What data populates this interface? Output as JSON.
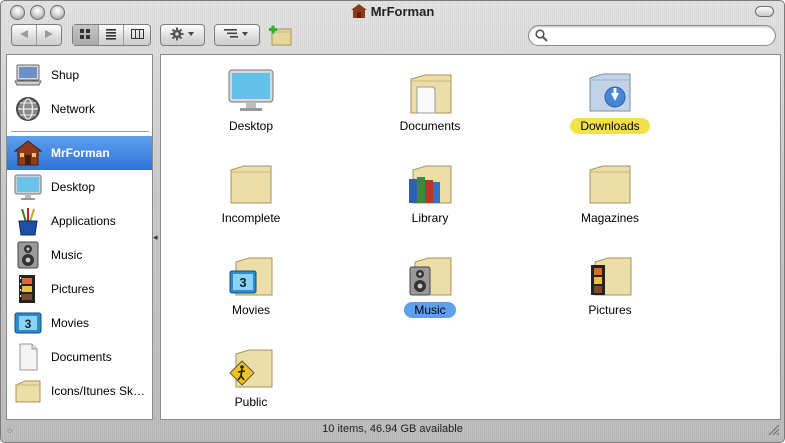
{
  "window": {
    "title": "MrForman"
  },
  "toolbar": {
    "back_icon": "back-arrow-icon",
    "forward_icon": "forward-arrow-icon",
    "view_icons": "icon-view-icon",
    "view_list": "list-view-icon",
    "view_columns": "column-view-icon",
    "action_icon": "gear-icon",
    "arrange_icon": "arrange-icon",
    "new_folder_icon": "new-folder-icon",
    "search_placeholder": "",
    "search_value": ""
  },
  "sidebar": {
    "devices": [
      {
        "label": "Shup",
        "icon": "laptop-icon"
      },
      {
        "label": "Network",
        "icon": "network-globe-icon"
      }
    ],
    "places": [
      {
        "label": "MrForman",
        "icon": "home-icon",
        "selected": true
      },
      {
        "label": "Desktop",
        "icon": "desktop-icon"
      },
      {
        "label": "Applications",
        "icon": "applications-icon"
      },
      {
        "label": "Music",
        "icon": "music-folder-icon"
      },
      {
        "label": "Pictures",
        "icon": "pictures-folder-icon"
      },
      {
        "label": "Movies",
        "icon": "movies-folder-icon"
      },
      {
        "label": "Documents",
        "icon": "documents-icon"
      },
      {
        "label": "Icons/Itunes Sk…",
        "icon": "folder-icon"
      }
    ]
  },
  "items": [
    {
      "label": "Desktop",
      "icon": "desktop-icon"
    },
    {
      "label": "Documents",
      "icon": "documents-folder-icon"
    },
    {
      "label": "Downloads",
      "icon": "downloads-folder-icon",
      "label_color": "#f2e24a"
    },
    {
      "label": "Incomplete",
      "icon": "folder-icon"
    },
    {
      "label": "Library",
      "icon": "library-folder-icon"
    },
    {
      "label": "Magazines",
      "icon": "folder-icon"
    },
    {
      "label": "Movies",
      "icon": "movies-folder-icon"
    },
    {
      "label": "Music",
      "icon": "music-folder-icon",
      "label_color": "#5ea0ee"
    },
    {
      "label": "Pictures",
      "icon": "pictures-folder-icon"
    },
    {
      "label": "Public",
      "icon": "public-folder-icon"
    }
  ],
  "status": {
    "text": "10 items, 46.94 GB available"
  },
  "colors": {
    "selection": "#3d7fdf",
    "label_yellow": "#f2e24a",
    "label_blue": "#5ea0ee",
    "folder": "#e9dca6"
  }
}
